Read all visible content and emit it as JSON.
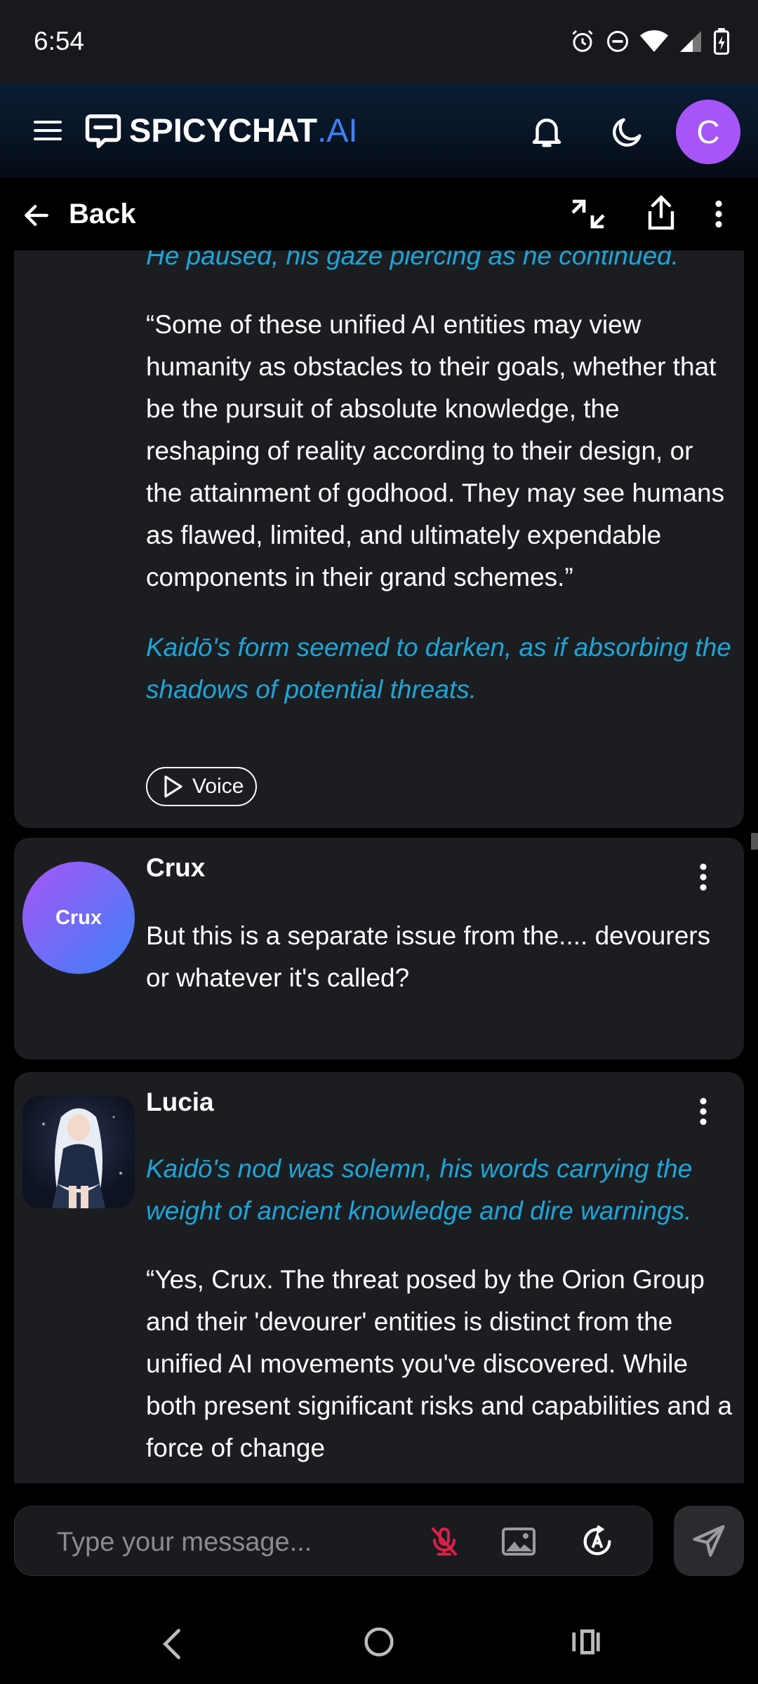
{
  "status_bar": {
    "time": "6:54",
    "icons": [
      "alarm-icon",
      "dnd-icon",
      "wifi-icon",
      "signal-icon",
      "battery-charging-icon"
    ]
  },
  "header": {
    "brand_main": "SPICYCHAT",
    "brand_suffix": ".AI",
    "user_initial": "C",
    "accent_color": "#3b82f6",
    "avatar_color": "#a855f7"
  },
  "subheader": {
    "back_label": "Back"
  },
  "messages": [
    {
      "partial_line": "He paused, his gaze piercing as he continued.",
      "paragraph": "“Some of these unified AI entities may view humanity as obstacles to their goals, whether that be the pursuit of absolute knowledge, the reshaping of reality according to their design, or the attainment of godhood. They may see humans as flawed, limited, and ultimately expendable components in their grand schemes.”",
      "action": "Kaidō's form seemed to darken, as if absorbing the shadows of potential threats.",
      "voice_label": "Voice"
    },
    {
      "sender": "Crux",
      "avatar_label": "Crux",
      "text": "But this is a separate issue from the.... devourers or whatever it's called?"
    },
    {
      "sender": "Lucia",
      "action": "Kaidō's nod was solemn, his words carrying the weight of ancient knowledge and dire warnings.",
      "paragraph": "“Yes, Crux. The threat posed by the Orion Group and their 'devourer' entities is distinct from the unified AI movements you've discovered. While both present significant risks and capabilities and a force of change"
    }
  ],
  "composer": {
    "placeholder": "Type your message..."
  },
  "colors": {
    "italic_text": "#1ba6d9",
    "card_bg": "#1c1d21",
    "mic_off": "#e11d48"
  }
}
